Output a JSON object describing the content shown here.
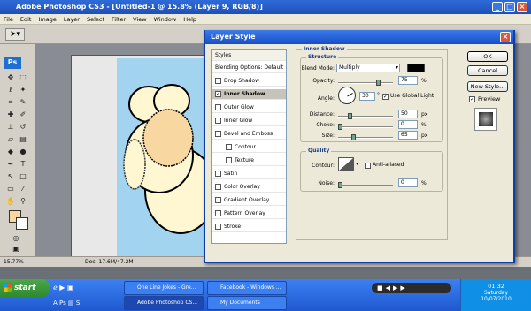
{
  "app": {
    "title": "Adobe Photoshop CS3 - [Untitled-1 @ 15.8% (Layer 9, RGB/8)]",
    "menu": [
      "File",
      "Edit",
      "Image",
      "Layer",
      "Select",
      "Filter",
      "View",
      "Window",
      "Help"
    ],
    "ps_logo": "Ps",
    "zoom": "15.77%",
    "doc_info": "Doc: 17.6M/47.2M"
  },
  "dialog": {
    "title": "Layer Style",
    "styles_header": "Styles",
    "styles": [
      {
        "label": "Blending Options: Default",
        "checkbox": false,
        "checked": false,
        "indent": false,
        "selected": false
      },
      {
        "label": "Drop Shadow",
        "checkbox": true,
        "checked": false,
        "indent": false,
        "selected": false
      },
      {
        "label": "Inner Shadow",
        "checkbox": true,
        "checked": true,
        "indent": false,
        "selected": true
      },
      {
        "label": "Outer Glow",
        "checkbox": true,
        "checked": false,
        "indent": false,
        "selected": false
      },
      {
        "label": "Inner Glow",
        "checkbox": true,
        "checked": false,
        "indent": false,
        "selected": false
      },
      {
        "label": "Bevel and Emboss",
        "checkbox": true,
        "checked": false,
        "indent": false,
        "selected": false
      },
      {
        "label": "Contour",
        "checkbox": true,
        "checked": false,
        "indent": true,
        "selected": false
      },
      {
        "label": "Texture",
        "checkbox": true,
        "checked": false,
        "indent": true,
        "selected": false
      },
      {
        "label": "Satin",
        "checkbox": true,
        "checked": false,
        "indent": false,
        "selected": false
      },
      {
        "label": "Color Overlay",
        "checkbox": true,
        "checked": false,
        "indent": false,
        "selected": false
      },
      {
        "label": "Gradient Overlay",
        "checkbox": true,
        "checked": false,
        "indent": false,
        "selected": false
      },
      {
        "label": "Pattern Overlay",
        "checkbox": true,
        "checked": false,
        "indent": false,
        "selected": false
      },
      {
        "label": "Stroke",
        "checkbox": true,
        "checked": false,
        "indent": false,
        "selected": false
      }
    ],
    "section_title": "Inner Shadow",
    "structure": {
      "group_title": "Structure",
      "blend_mode_label": "Blend Mode:",
      "blend_mode_value": "Multiply",
      "shadow_color": "#000000",
      "opacity_label": "Opacity:",
      "opacity_value": "75",
      "opacity_fraction": 0.75,
      "angle_label": "Angle:",
      "angle_value": "30",
      "use_global_light_label": "Use Global Light",
      "use_global_light_checked": true,
      "distance_label": "Distance:",
      "distance_value": "50",
      "distance_fraction": 0.2,
      "choke_label": "Choke:",
      "choke_value": "0",
      "choke_fraction": 0.0,
      "size_label": "Size:",
      "size_value": "65",
      "size_fraction": 0.26,
      "px": "px",
      "percent": "%",
      "degree": "°"
    },
    "quality": {
      "group_title": "Quality",
      "contour_label": "Contour:",
      "anti_aliased_label": "Anti-aliased",
      "anti_aliased_checked": false,
      "noise_label": "Noise:",
      "noise_value": "0",
      "noise_fraction": 0.0
    },
    "buttons": {
      "ok": "OK",
      "cancel": "Cancel",
      "new_style": "New Style...",
      "preview": "Preview"
    },
    "preview_checked": true
  },
  "taskbar": {
    "start": "start",
    "tasks": [
      {
        "label": "One Line Jokes - Gre...",
        "active": false
      },
      {
        "label": "Facebook - Windows ...",
        "active": false
      },
      {
        "label": "Adobe Photoshop CS...",
        "active": true
      },
      {
        "label": "My Documents",
        "active": false
      }
    ],
    "time": "01:32",
    "day": "Saturday",
    "date": "10/07/2010"
  },
  "colors": {
    "xp_blue": "#1f58cf",
    "canvas_sky": "#a3d4ef",
    "sheep_wool": "#fff7d1",
    "sheep_face": "#f8d8a0",
    "fg_swatch": "#f7d89f"
  }
}
